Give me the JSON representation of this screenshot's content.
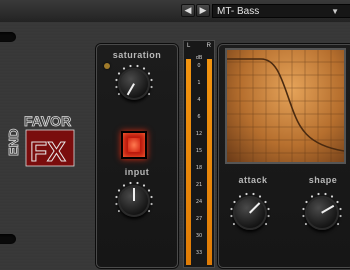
{
  "preset_bar": {
    "prev_glyph": "◀",
    "next_glyph": "▶",
    "preset_name": "MT- Bass",
    "dropdown_glyph": "▼"
  },
  "plugin": {
    "logo_text": [
      "END",
      "FAVOR",
      "FX"
    ]
  },
  "saturation": {
    "label": "saturation"
  },
  "input": {
    "label": "input"
  },
  "meter": {
    "left_label": "L",
    "right_label": "R",
    "scale": [
      "dB",
      "0",
      "1",
      "4",
      "6",
      "12",
      "15",
      "18",
      "21",
      "24",
      "27",
      "30",
      "33"
    ]
  },
  "attack": {
    "label": "attack"
  },
  "shape": {
    "label": "shape"
  },
  "colors": {
    "accent": "#f29410",
    "button_red": "#d1200f"
  }
}
